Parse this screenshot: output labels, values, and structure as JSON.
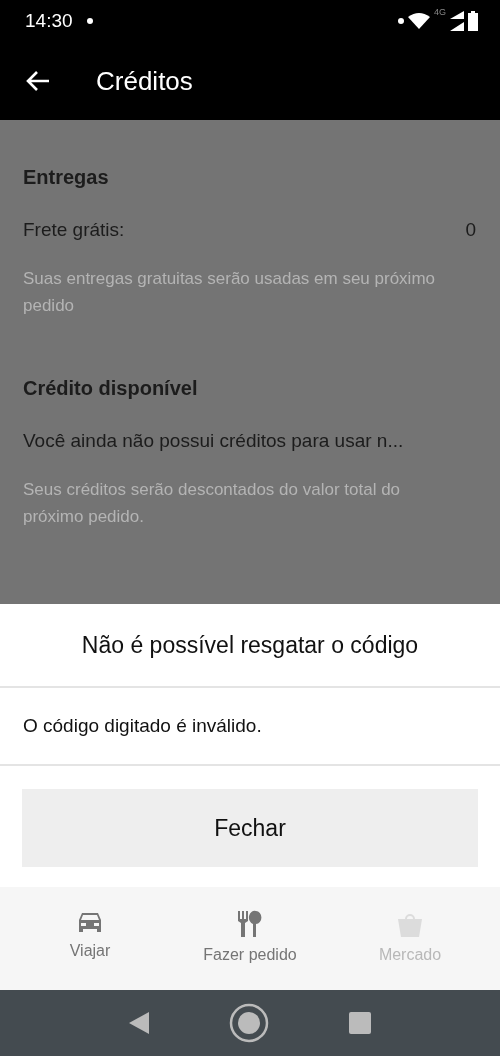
{
  "status_bar": {
    "time": "14:30",
    "network": "4G"
  },
  "app_bar": {
    "title": "Créditos"
  },
  "sections": [
    {
      "title": "Entregas",
      "row_label": "Frete grátis:",
      "row_value": "0",
      "note": "Suas entregas gratuitas serão usadas em seu próximo pedido"
    },
    {
      "title": "Crédito disponível",
      "row_label": "Você ainda não possui créditos para usar n...",
      "note": "Seus créditos serão descontados do valor total do próximo pedido."
    }
  ],
  "dialog": {
    "title": "Não é possível resgatar o código",
    "message": "O código digitado é inválido.",
    "button": "Fechar"
  },
  "bottom_nav": [
    {
      "kind": "car",
      "label": "Viajar",
      "disabled": false
    },
    {
      "kind": "food",
      "label": "Fazer pedido",
      "disabled": false
    },
    {
      "kind": "bag",
      "label": "Mercado",
      "disabled": true
    }
  ]
}
